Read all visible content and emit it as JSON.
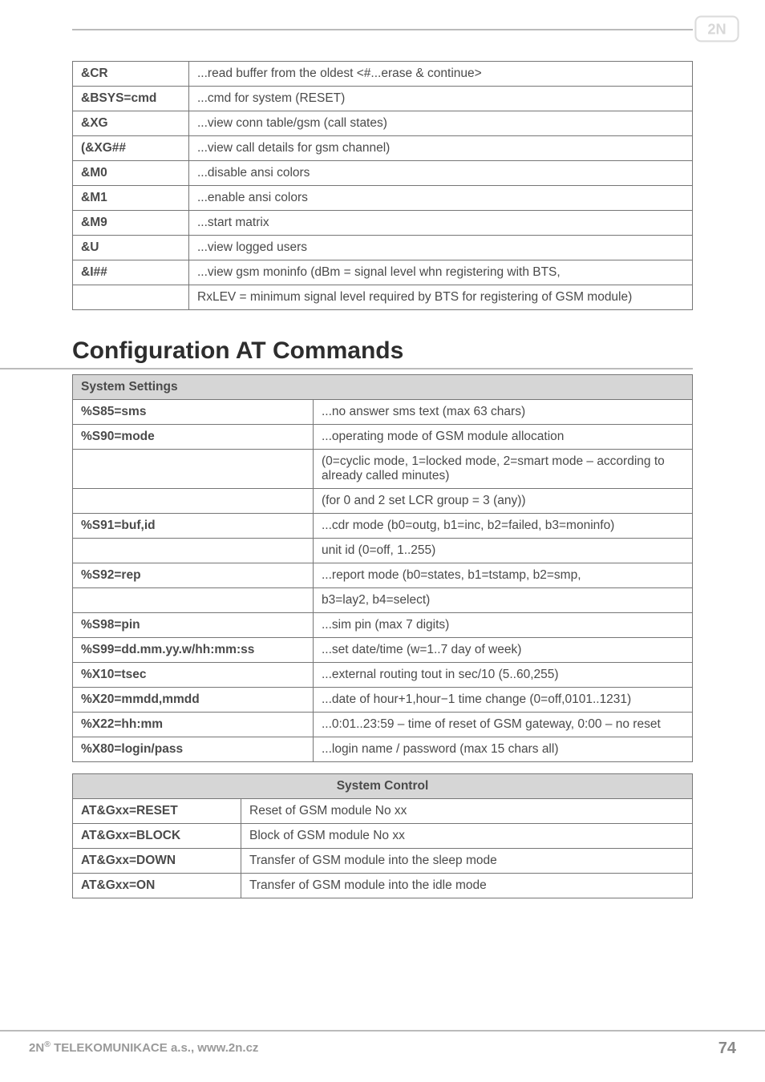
{
  "logo_text": "2N",
  "table1": {
    "rows": [
      {
        "k": "&CR",
        "v": "...read buffer from the oldest <#...erase & continue>"
      },
      {
        "k": "&BSYS=cmd",
        "v": "...cmd for system (RESET)"
      },
      {
        "k": "&XG",
        "v": "...view conn table/gsm (call states)"
      },
      {
        "k": "(&XG##",
        "v": "...view call details for gsm channel)"
      },
      {
        "k": "&M0",
        "v": "...disable ansi colors"
      },
      {
        "k": "&M1",
        "v": "...enable ansi colors"
      },
      {
        "k": "&M9",
        "v": "...start matrix"
      },
      {
        "k": "&U",
        "v": "...view logged users"
      },
      {
        "k": "&I##",
        "v": "...view gsm moninfo (dBm = signal level whn registering with BTS,"
      },
      {
        "k": "",
        "v": "RxLEV = minimum signal level required by BTS for registering of GSM module)"
      }
    ]
  },
  "section_title": "Configuration AT Commands",
  "table2": {
    "caption": "System Settings",
    "rows": [
      {
        "k": "%S85=sms",
        "v": "...no answer sms text (max 63 chars)"
      },
      {
        "k": "%S90=mode",
        "v": "...operating mode of GSM module allocation"
      },
      {
        "k": "",
        "v": "(0=cyclic mode, 1=locked mode, 2=smart mode – according to already called minutes)"
      },
      {
        "k": "",
        "v": "(for 0 and 2 set LCR group = 3 (any))"
      },
      {
        "k": "%S91=buf,id",
        "v": "...cdr mode (b0=outg, b1=inc, b2=failed, b3=moninfo)"
      },
      {
        "k": "",
        "v": "unit id (0=off, 1..255)"
      },
      {
        "k": "%S92=rep",
        "v": "...report mode (b0=states, b1=tstamp, b2=smp,"
      },
      {
        "k": "",
        "v": "b3=lay2, b4=select)"
      },
      {
        "k": "%S98=pin",
        "v": "...sim pin (max 7 digits)"
      },
      {
        "k": "%S99=dd.mm.yy.w/hh:mm:ss",
        "v": "...set date/time (w=1..7 day of week)"
      },
      {
        "k": "%X10=tsec",
        "v": "...external routing tout in sec/10 (5..60,255)"
      },
      {
        "k": "%X20=mmdd,mmdd",
        "v": "...date of hour+1,hour−1 time change (0=off,0101..1231)"
      },
      {
        "k": "%X22=hh:mm",
        "v": "...0:01..23:59 – time of reset of GSM gateway, 0:00 – no reset"
      },
      {
        "k": "%X80=login/pass",
        "v": "...login name / password (max 15 chars all)"
      }
    ]
  },
  "table3": {
    "caption": "System Control",
    "rows": [
      {
        "k": "AT&Gxx=RESET",
        "v": "Reset of GSM module No xx"
      },
      {
        "k": "AT&Gxx=BLOCK",
        "v": "Block of GSM module No xx"
      },
      {
        "k": "AT&Gxx=DOWN",
        "v": "Transfer of GSM module into the sleep mode"
      },
      {
        "k": "AT&Gxx=ON",
        "v": "Transfer of GSM module into the idle mode"
      }
    ]
  },
  "footer": {
    "left_prefix": "2N",
    "left_suffix": " TELEKOMUNIKACE a.s., www.2n.cz",
    "page": "74"
  }
}
